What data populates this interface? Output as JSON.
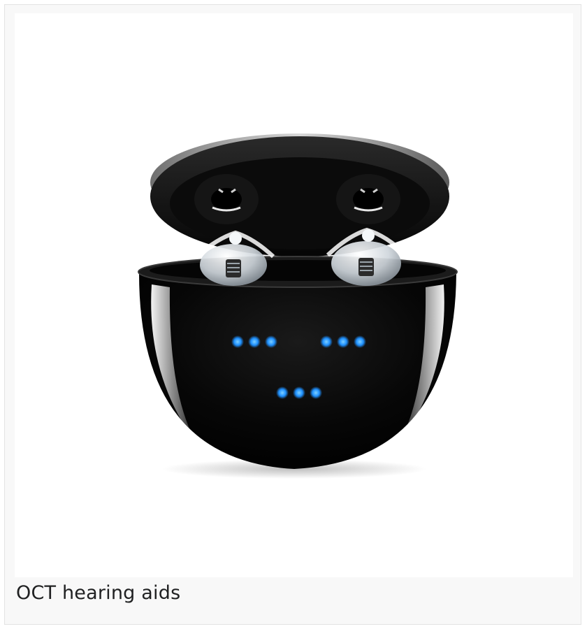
{
  "caption": "OCT hearing aids",
  "image": {
    "subject": "hearing-aids-charging-case",
    "colors": {
      "case_body": "#080808",
      "case_rim": "#1b1b1b",
      "led": "#1e90ff",
      "earpiece": "#e9eef2",
      "background": "#ffffff",
      "frame": "#f8f8f8"
    },
    "led_groups": 3,
    "leds_per_group": 3
  }
}
